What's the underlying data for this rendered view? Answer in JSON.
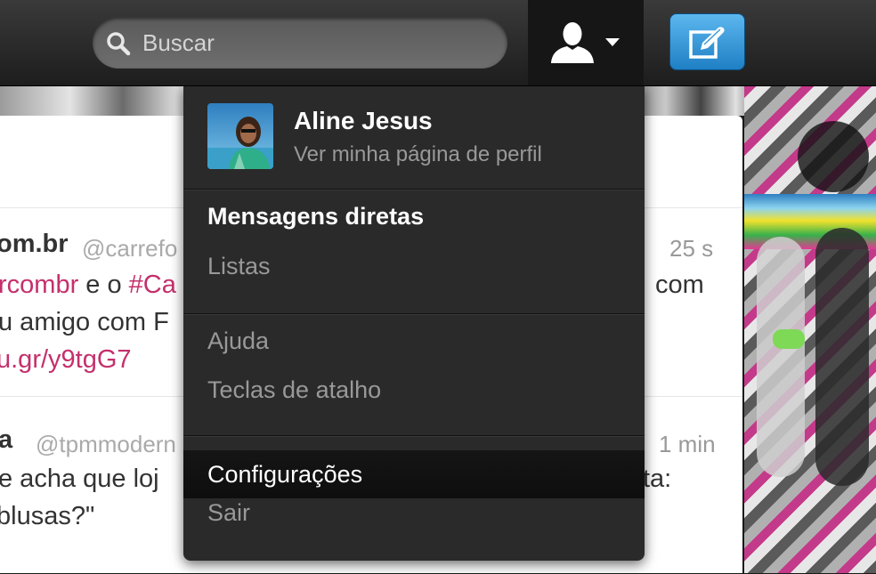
{
  "topbar": {
    "search": {
      "placeholder": "Buscar",
      "value": ""
    },
    "icons": {
      "search": "search-icon",
      "user": "user-icon",
      "caret": "caret-down-icon",
      "compose": "compose-tweet-icon"
    },
    "colors": {
      "compose_button": "#2b8fd6",
      "link": "#c4306c"
    }
  },
  "dropdown": {
    "profile": {
      "name": "Aline Jesus",
      "subtitle": "Ver minha página de perfil"
    },
    "items": [
      {
        "label": "Mensagens diretas"
      },
      {
        "label": "Listas"
      },
      {
        "label": "Ajuda"
      },
      {
        "label": "Teclas de atalho"
      },
      {
        "label": "Configurações"
      },
      {
        "label": "Sair"
      }
    ]
  },
  "timeline": {
    "tweets": [
      {
        "name": "om.br",
        "handle": "@carrefo",
        "time": "25 s",
        "line1": {
          "link1": "rcombr",
          "text": " e o ",
          "hashtag": "#Ca",
          "end": "com"
        },
        "line2": "u amigo com F",
        "line3": "u.gr/y9tgG7"
      },
      {
        "name": "a",
        "handle": "@tpmmodern",
        "time": "1 min",
        "line1": "e acha que loj",
        "line1_end": "ta:",
        "line2": " blusas?\""
      }
    ]
  }
}
